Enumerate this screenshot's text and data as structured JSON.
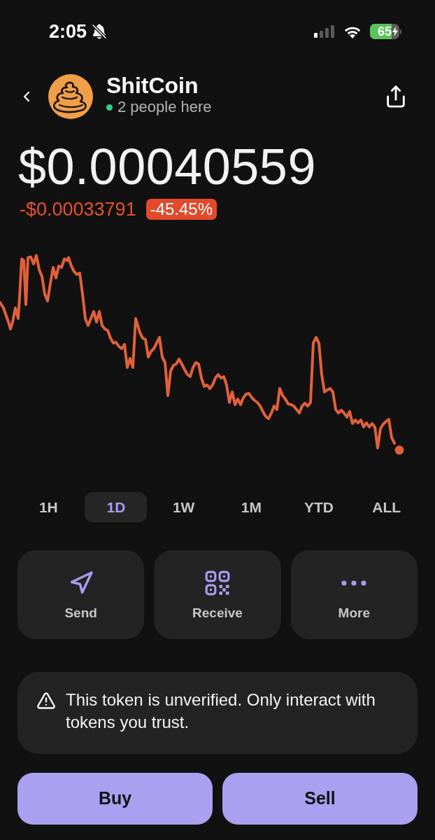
{
  "status_bar": {
    "time": "2:05",
    "silent": true,
    "battery": "65",
    "charging": true
  },
  "header": {
    "title": "ShitCoin",
    "presence": "2 people here"
  },
  "price": "$0.00040559",
  "change": {
    "amount": "-$0.00033791",
    "percent": "-45.45%",
    "negative": true
  },
  "ranges": [
    {
      "label": "1H",
      "selected": false
    },
    {
      "label": "1D",
      "selected": true
    },
    {
      "label": "1W",
      "selected": false
    },
    {
      "label": "1M",
      "selected": false
    },
    {
      "label": "YTD",
      "selected": false
    },
    {
      "label": "ALL",
      "selected": false
    }
  ],
  "actions": [
    {
      "kind": "send",
      "label": "Send"
    },
    {
      "kind": "receive",
      "label": "Receive"
    },
    {
      "kind": "more",
      "label": "More"
    }
  ],
  "warning": "This token is unverified. Only interact with tokens you trust.",
  "trade_buttons": [
    {
      "label": "Buy"
    },
    {
      "label": "Sell"
    }
  ]
}
